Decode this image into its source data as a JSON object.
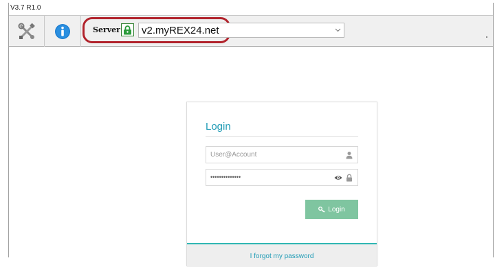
{
  "window": {
    "version": "V3.7 R1.0"
  },
  "toolbar": {
    "tools_icon": "tools-icon",
    "info_icon": "info-icon",
    "server": {
      "label": "Server",
      "value": "v2.myREX24.net",
      "lock_icon": "lock-icon",
      "dropdown_icon": "chevron-down-icon"
    }
  },
  "login": {
    "title": "Login",
    "user_placeholder": "User@Account",
    "password_mask": "••••••••••••••",
    "user_icon": "user-icon",
    "eye_icon": "eye-icon",
    "password_lock_icon": "lock-icon",
    "button_label": "Login",
    "button_icon": "key-icon",
    "forgot_link": "I forgot my password"
  },
  "colors": {
    "accent_teal": "#1f9bb5",
    "button_green": "#7fc5a0",
    "highlight_red": "#b1222b",
    "lock_green": "#2a9b3a"
  }
}
